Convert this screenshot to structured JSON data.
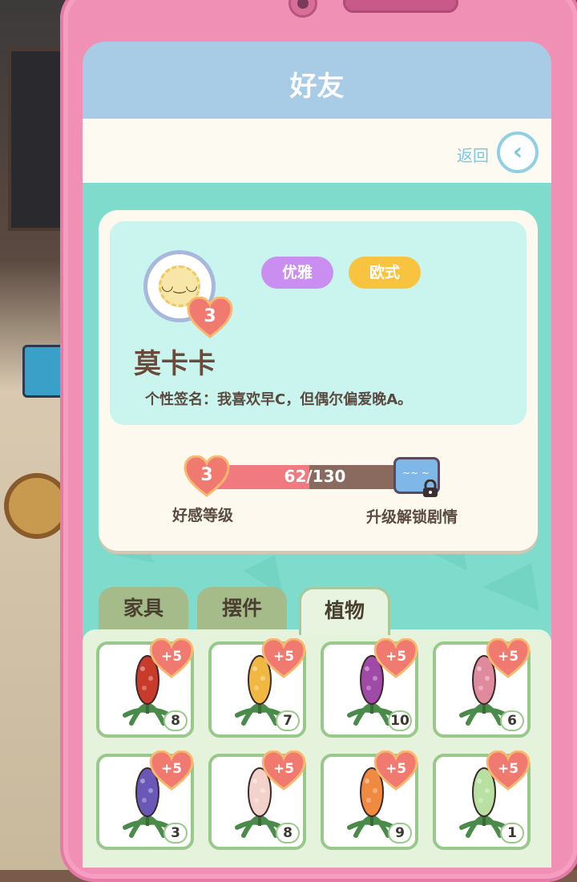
{
  "title": "好友",
  "back_label": "返回",
  "profile": {
    "tags": [
      "优雅",
      "欧式"
    ],
    "tag_colors": [
      "#c98ef0",
      "#f8c440"
    ],
    "heart_level": "3",
    "name": "莫卡卡",
    "signature": "个性签名：我喜欢早C，但偶尔偏爱晚A。"
  },
  "affinity": {
    "level": "3",
    "progress_text": "62/130",
    "current": 62,
    "max": 130,
    "label": "好感等级",
    "unlock_label": "升级解锁剧情"
  },
  "tabs": [
    "家具",
    "摆件",
    "植物"
  ],
  "active_tab": "植物",
  "items": [
    {
      "bonus": "+5",
      "count": "8",
      "color": "#c83a2a"
    },
    {
      "bonus": "+5",
      "count": "7",
      "color": "#f0b840"
    },
    {
      "bonus": "+5",
      "count": "10",
      "color": "#a04aa8"
    },
    {
      "bonus": "+5",
      "count": "6",
      "color": "#e08aa0"
    },
    {
      "bonus": "+5",
      "count": "3",
      "color": "#6a58b8"
    },
    {
      "bonus": "+5",
      "count": "8",
      "color": "#f4d2cc"
    },
    {
      "bonus": "+5",
      "count": "9",
      "color": "#f08a40"
    },
    {
      "bonus": "+5",
      "count": "1",
      "color": "#b8e0a0"
    }
  ]
}
